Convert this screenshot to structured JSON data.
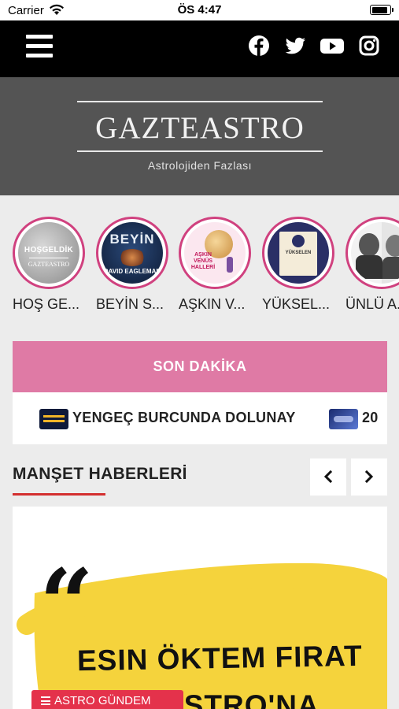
{
  "status_bar": {
    "carrier": "Carrier",
    "time": "ÖS 4:47",
    "battery_level": 0.9
  },
  "top_nav": {
    "menu_icon": "hamburger-menu-icon",
    "social_icons": [
      "facebook-icon",
      "twitter-icon",
      "youtube-icon",
      "instagram-icon"
    ]
  },
  "brand": {
    "name": "GAZTEASTRO",
    "tagline": "Astrolojiden Fazlası"
  },
  "stories": [
    {
      "label": "HOŞ GE...",
      "image_text": "HOŞGELDİK",
      "image_subtext": "GAZTEASTRO"
    },
    {
      "label": "BEYİN S...",
      "image_text": "BEYİN",
      "image_subtext": "DAVID EAGLEMAN"
    },
    {
      "label": "AŞKIN V...",
      "image_text": "AŞKIN VENÜS HALLERİ"
    },
    {
      "label": "YÜKSEL...",
      "image_text": "YÜKSELEN"
    },
    {
      "label": "ÜNLÜ A..."
    }
  ],
  "breaking_news": {
    "title": "SON DAKİKA",
    "items": [
      {
        "text": "YENGEÇ BURCUNDA DOLUNAY"
      },
      {
        "text": "20"
      }
    ]
  },
  "headlines": {
    "title": "MANŞET HABERLERİ",
    "prev_icon": "chevron-left-icon",
    "next_icon": "chevron-right-icon",
    "card": {
      "quote_mark": "“",
      "line1": "ESIN ÖKTEM FIRAT",
      "line2": "ASTRO'NA",
      "category": "ASTRO GÜNDEM"
    }
  },
  "colors": {
    "nav_bg": "#000000",
    "brand_bg": "#545454",
    "accent_pink": "#df7aa5",
    "story_ring": "#d0417f",
    "section_underline": "#d32f2f",
    "badge_red": "#e4324b",
    "headline_yellow": "#f5d33c"
  }
}
